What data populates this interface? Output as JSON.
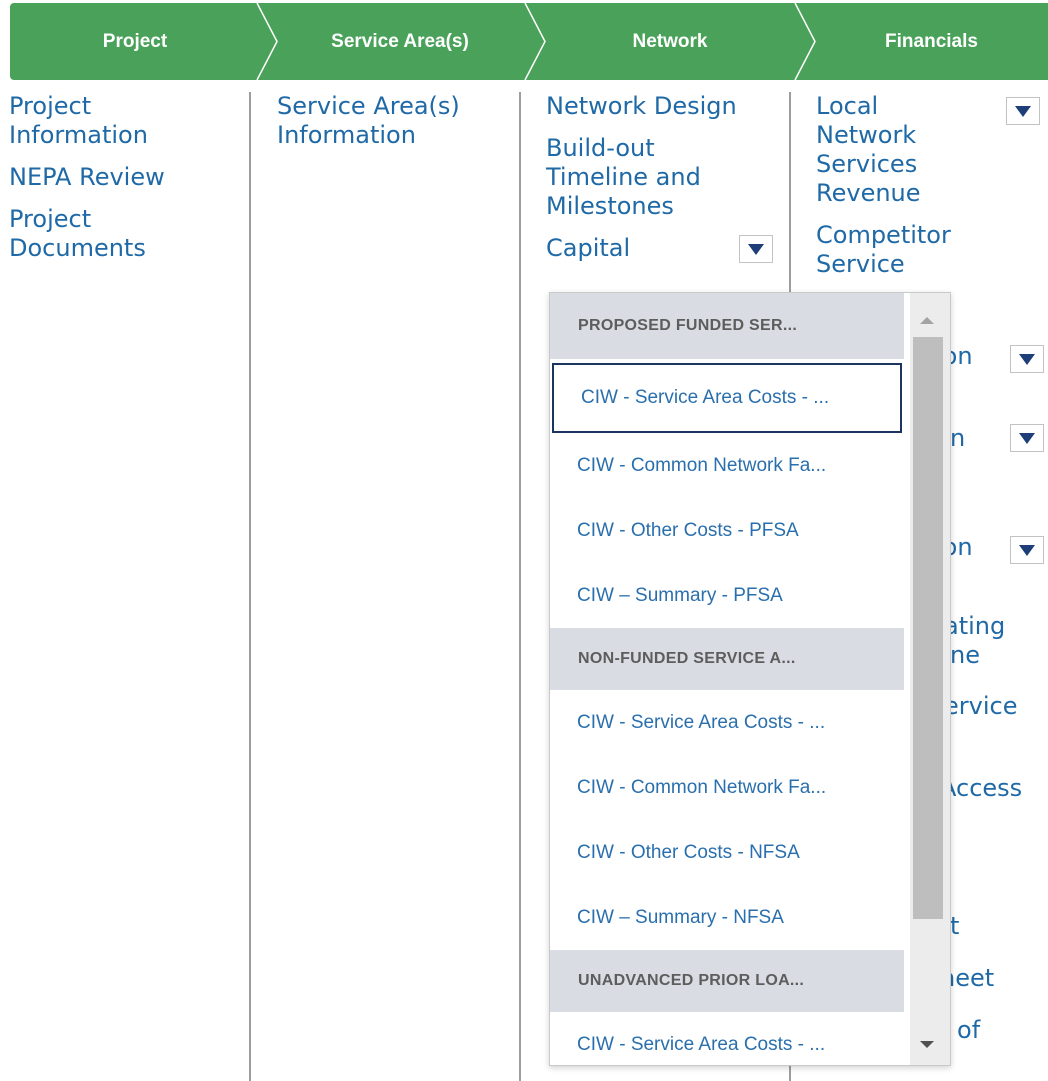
{
  "steps": [
    {
      "label": "Project"
    },
    {
      "label": "Service Area(s)"
    },
    {
      "label": "Network"
    },
    {
      "label": "Financials"
    }
  ],
  "project_links": [
    "Project Information",
    "NEPA Review",
    "Project Documents"
  ],
  "service_links": [
    "Service Area(s) Information"
  ],
  "network_links": [
    "Network Design",
    "Build-out Timeline and Milestones",
    "Capital"
  ],
  "financial_links": [
    "Local Network Services Revenue",
    "Competitor Service"
  ],
  "financial_peek": [
    "ion",
    "n",
    "ion",
    "ating",
    "ne",
    "ervice",
    "Access",
    "t",
    "heet",
    "t of"
  ],
  "dropdown": {
    "groups": [
      {
        "header": "PROPOSED FUNDED SER...",
        "options": [
          "CIW - Service Area Costs - ...",
          "CIW - Common Network Fa...",
          "CIW - Other Costs - PFSA",
          "CIW – Summary - PFSA"
        ]
      },
      {
        "header": "NON-FUNDED SERVICE A...",
        "options": [
          "CIW - Service Area Costs - ...",
          "CIW - Common Network Fa...",
          "CIW - Other Costs - NFSA",
          "CIW – Summary - NFSA"
        ]
      },
      {
        "header": "UNADVANCED PRIOR LOA...",
        "options": [
          "CIW - Service Area Costs - ..."
        ]
      }
    ]
  },
  "icons": {
    "dropdown": "caret-down-icon",
    "scroll_up": "scroll-up-icon",
    "scroll_down": "scroll-down-icon"
  },
  "colors": {
    "stepbar": "#4aa25a",
    "link": "#1f69a6",
    "group_bg": "#d9dce2",
    "selected_border": "#1c355e"
  }
}
